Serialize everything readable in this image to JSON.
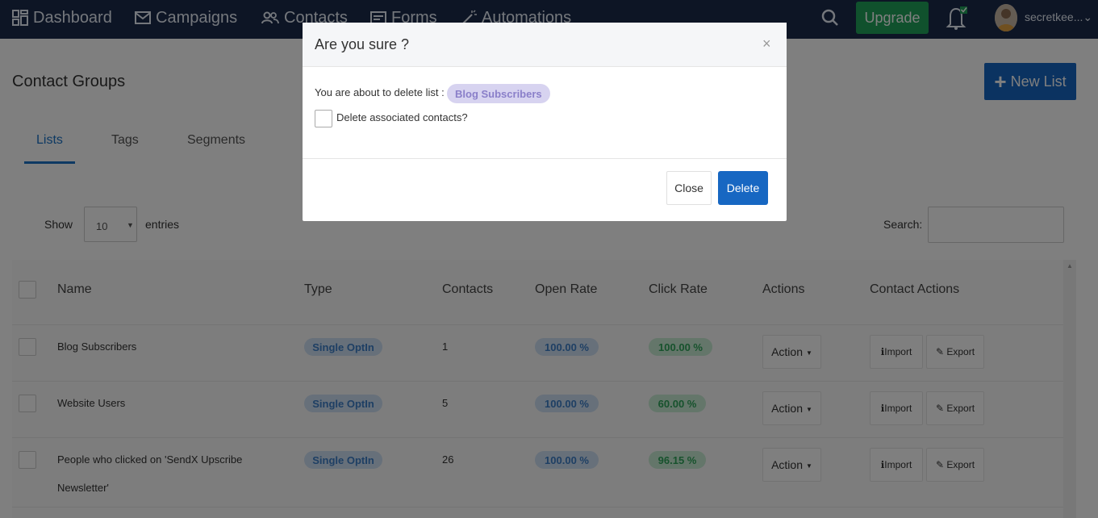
{
  "nav": {
    "dashboard": "Dashboard",
    "campaigns": "Campaigns",
    "contacts": "Contacts",
    "forms": "Forms",
    "automations": "Automations",
    "upgrade": "Upgrade",
    "user_name": "secretkee...",
    "user_chevron": "⌄"
  },
  "page": {
    "title": "Contact Groups",
    "new_list_plus": "+",
    "new_list_label": "New List",
    "tabs": [
      "Lists",
      "Tags",
      "Segments"
    ],
    "show_label": "Show",
    "entries_value": "10",
    "entries_arrow": "▼",
    "entries_label": "entries",
    "search_label": "Search:",
    "scroll_up": "▲"
  },
  "table": {
    "headers": [
      "Name",
      "Type",
      "Contacts",
      "Open Rate",
      "Click Rate",
      "Actions",
      "Contact Actions"
    ],
    "rows": [
      {
        "name_line1": "Blog Subscribers",
        "name_line2": "",
        "type": "Single OptIn",
        "contacts": "1",
        "open_rate": "100.00 %",
        "click_rate": "100.00 %"
      },
      {
        "name_line1": "Website Users",
        "name_line2": "",
        "type": "Single OptIn",
        "contacts": "5",
        "open_rate": "100.00 %",
        "click_rate": "60.00 %"
      },
      {
        "name_line1": "People who clicked on 'SendX Upscribe",
        "name_line2": "Newsletter'",
        "type": "Single OptIn",
        "contacts": "26",
        "open_rate": "100.00 %",
        "click_rate": "96.15 %"
      }
    ],
    "action_label": "Action",
    "caret": "▼",
    "import_icon": "ℹ",
    "import_label": "Import",
    "export_icon": "✎",
    "export_label": "Export"
  },
  "modal": {
    "title": "Are you sure ?",
    "close_x": "×",
    "message": "You are about to delete list :",
    "list_name": "Blog Subscribers",
    "checkbox_label": "Delete associated contacts?",
    "close_button": "Close",
    "delete_button": "Delete"
  },
  "colors": {
    "nav_bg": "#1a2b4a",
    "primary": "#1767c2",
    "upgrade": "#21a35a",
    "tab_active": "#1a73c6"
  }
}
